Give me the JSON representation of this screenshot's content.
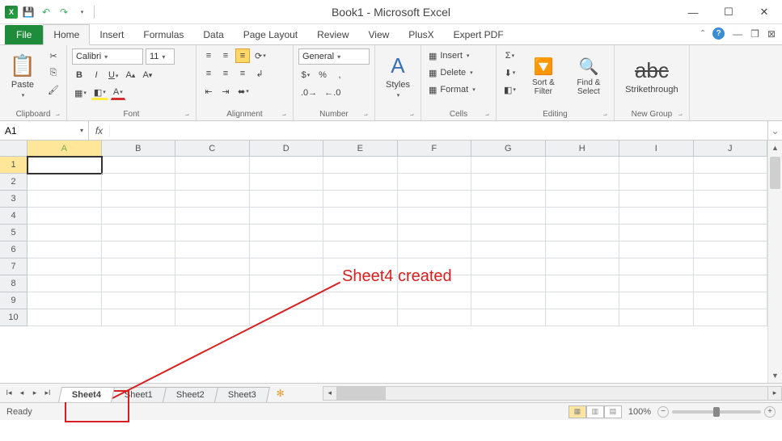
{
  "window": {
    "title": "Book1 - Microsoft Excel"
  },
  "ribbon": {
    "file": "File",
    "tabs": [
      "Home",
      "Insert",
      "Formulas",
      "Data",
      "Page Layout",
      "Review",
      "View",
      "PlusX",
      "Expert PDF"
    ],
    "active_tab": "Home"
  },
  "groups": {
    "clipboard": {
      "label": "Clipboard",
      "paste": "Paste"
    },
    "font": {
      "label": "Font",
      "name": "Calibri",
      "size": "11"
    },
    "alignment": {
      "label": "Alignment"
    },
    "number": {
      "label": "Number",
      "format": "General"
    },
    "styles": {
      "label": "",
      "btn": "Styles"
    },
    "cells": {
      "label": "Cells",
      "insert": "Insert",
      "delete": "Delete",
      "format": "Format"
    },
    "editing": {
      "label": "Editing",
      "sort": "Sort & Filter",
      "find": "Find & Select"
    },
    "newgroup": {
      "label": "New Group",
      "strike": "Strikethrough"
    }
  },
  "formula_bar": {
    "namebox": "A1",
    "formula": ""
  },
  "grid": {
    "columns": [
      "A",
      "B",
      "C",
      "D",
      "E",
      "F",
      "G",
      "H",
      "I",
      "J"
    ],
    "rows": [
      "1",
      "2",
      "3",
      "4",
      "5",
      "6",
      "7",
      "8",
      "9",
      "10"
    ],
    "active_cell": "A1"
  },
  "sheets": {
    "tabs": [
      "Sheet4",
      "Sheet1",
      "Sheet2",
      "Sheet3"
    ],
    "active": "Sheet4"
  },
  "status": {
    "ready": "Ready",
    "zoom": "100%"
  },
  "annotation": {
    "text": "Sheet4 created"
  }
}
